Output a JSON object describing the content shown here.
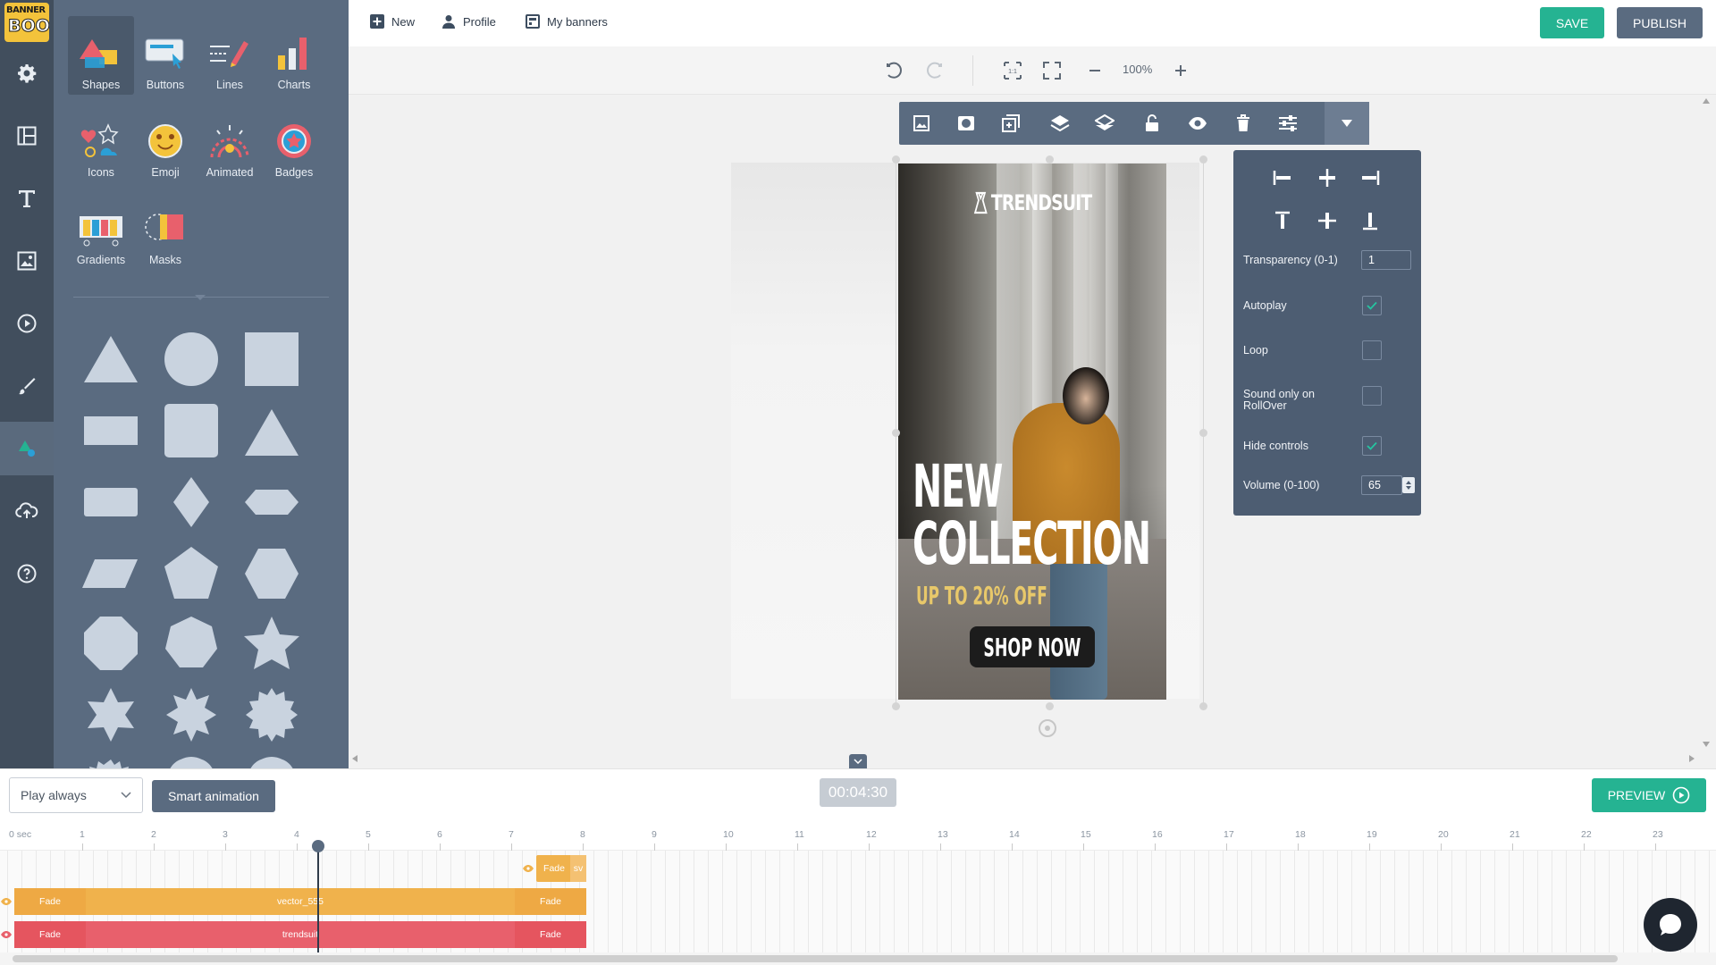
{
  "app": {
    "logo_line1": "BANNER",
    "logo_line2": "BOO"
  },
  "topbar": {
    "new_label": "New",
    "profile_label": "Profile",
    "my_banners_label": "My banners",
    "save_label": "SAVE",
    "publish_label": "PUBLISH"
  },
  "toolbar": {
    "zoom": "100%"
  },
  "panel": {
    "categories": [
      {
        "label": "Shapes",
        "icon": "shapes-icon"
      },
      {
        "label": "Buttons",
        "icon": "buttons-icon"
      },
      {
        "label": "Lines",
        "icon": "lines-icon"
      },
      {
        "label": "Charts",
        "icon": "charts-icon"
      },
      {
        "label": "Icons",
        "icon": "icons-icon"
      },
      {
        "label": "Emoji",
        "icon": "emoji-icon"
      },
      {
        "label": "Animated",
        "icon": "animated-icon"
      },
      {
        "label": "Badges",
        "icon": "badges-icon"
      },
      {
        "label": "Gradients",
        "icon": "gradients-icon"
      },
      {
        "label": "Masks",
        "icon": "masks-icon"
      }
    ],
    "shapes": [
      "triangle",
      "circle",
      "square",
      "rectangle",
      "rounded-square",
      "triangle",
      "rounded-rectangle",
      "diamond",
      "hexagon-wide",
      "parallelogram",
      "pentagon",
      "hexagon",
      "octagon",
      "heptagon",
      "star",
      "star-6",
      "star-8",
      "star-12"
    ]
  },
  "banner": {
    "brand": "TRENDSUIT",
    "headline_line1": "NEW",
    "headline_line2": "COLLECTION",
    "offer": "UP TO 20% OFF",
    "cta": "SHOP NOW"
  },
  "properties": {
    "transparency_label": "Transparency (0-1)",
    "transparency_value": "1",
    "autoplay_label": "Autoplay",
    "autoplay_checked": true,
    "loop_label": "Loop",
    "loop_checked": false,
    "sound_label_line1": "Sound only on",
    "sound_label_line2": "RollOver",
    "sound_checked": false,
    "hide_controls_label": "Hide controls",
    "hide_controls_checked": true,
    "volume_label": "Volume (0-100)",
    "volume_value": "65"
  },
  "bottom": {
    "play_mode": "Play always",
    "smart_animation_label": "Smart animation",
    "time": "00:04:30",
    "preview_label": "PREVIEW"
  },
  "timeline": {
    "start_label": "0 sec",
    "ticks": [
      "1",
      "2",
      "3",
      "4",
      "5",
      "6",
      "7",
      "8",
      "9",
      "10",
      "11",
      "12",
      "13",
      "14",
      "15",
      "16",
      "17",
      "18",
      "19",
      "20",
      "21",
      "22",
      "23"
    ],
    "tracks": [
      {
        "in": "Fade",
        "name": "",
        "out": "sv",
        "color": "#f0b24c"
      },
      {
        "in": "Fade",
        "name": "vector_555",
        "out": "Fade",
        "color": "#f0b24c"
      },
      {
        "in": "Fade",
        "name": "trendsuit",
        "out": "Fade",
        "color": "#e8606c"
      }
    ],
    "playhead_seconds": 4.3
  },
  "colors": {
    "accent_green": "#25b392",
    "panel_slate": "#5a6b80",
    "rail_dark": "#414e5d",
    "track_orange": "#f0b24c",
    "track_red": "#e8606c"
  }
}
